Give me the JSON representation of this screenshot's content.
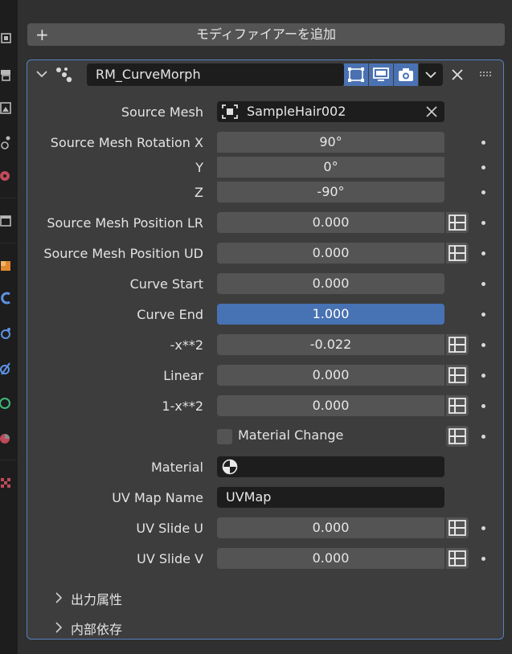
{
  "add_modifier": {
    "label": "モディファイアーを追加"
  },
  "modifier": {
    "name": "RM_CurveMorph",
    "colors": {
      "accent": "#4772b3",
      "border": "#5680c2",
      "field": "#545454",
      "dark_field": "#1d1d1d"
    }
  },
  "props": {
    "source_mesh": {
      "label": "Source Mesh",
      "value": "SampleHair002"
    },
    "rot_x": {
      "label": "Source Mesh Rotation X",
      "value": "90°"
    },
    "rot_y": {
      "label": "Y",
      "value": "0°"
    },
    "rot_z": {
      "label": "Z",
      "value": "-90°"
    },
    "pos_lr": {
      "label": "Source Mesh Position LR",
      "value": "0.000"
    },
    "pos_ud": {
      "label": "Source Mesh Position UD",
      "value": "0.000"
    },
    "curve_start": {
      "label": "Curve Start",
      "value": "0.000"
    },
    "curve_end": {
      "label": "Curve End",
      "value": "1.000"
    },
    "neg_x2": {
      "label": "-x**2",
      "value": "-0.022"
    },
    "linear": {
      "label": "Linear",
      "value": "0.000"
    },
    "one_minus_x2": {
      "label": "1-x**2",
      "value": "0.000"
    },
    "material_change": {
      "label": "Material Change",
      "checked": false
    },
    "material": {
      "label": "Material",
      "value": ""
    },
    "uv_map_name": {
      "label": "UV Map Name",
      "value": "UVMap"
    },
    "uv_slide_u": {
      "label": "UV Slide U",
      "value": "0.000"
    },
    "uv_slide_v": {
      "label": "UV Slide V",
      "value": "0.000"
    }
  },
  "subpanels": [
    {
      "label": "出力属性"
    },
    {
      "label": "内部依存"
    }
  ]
}
